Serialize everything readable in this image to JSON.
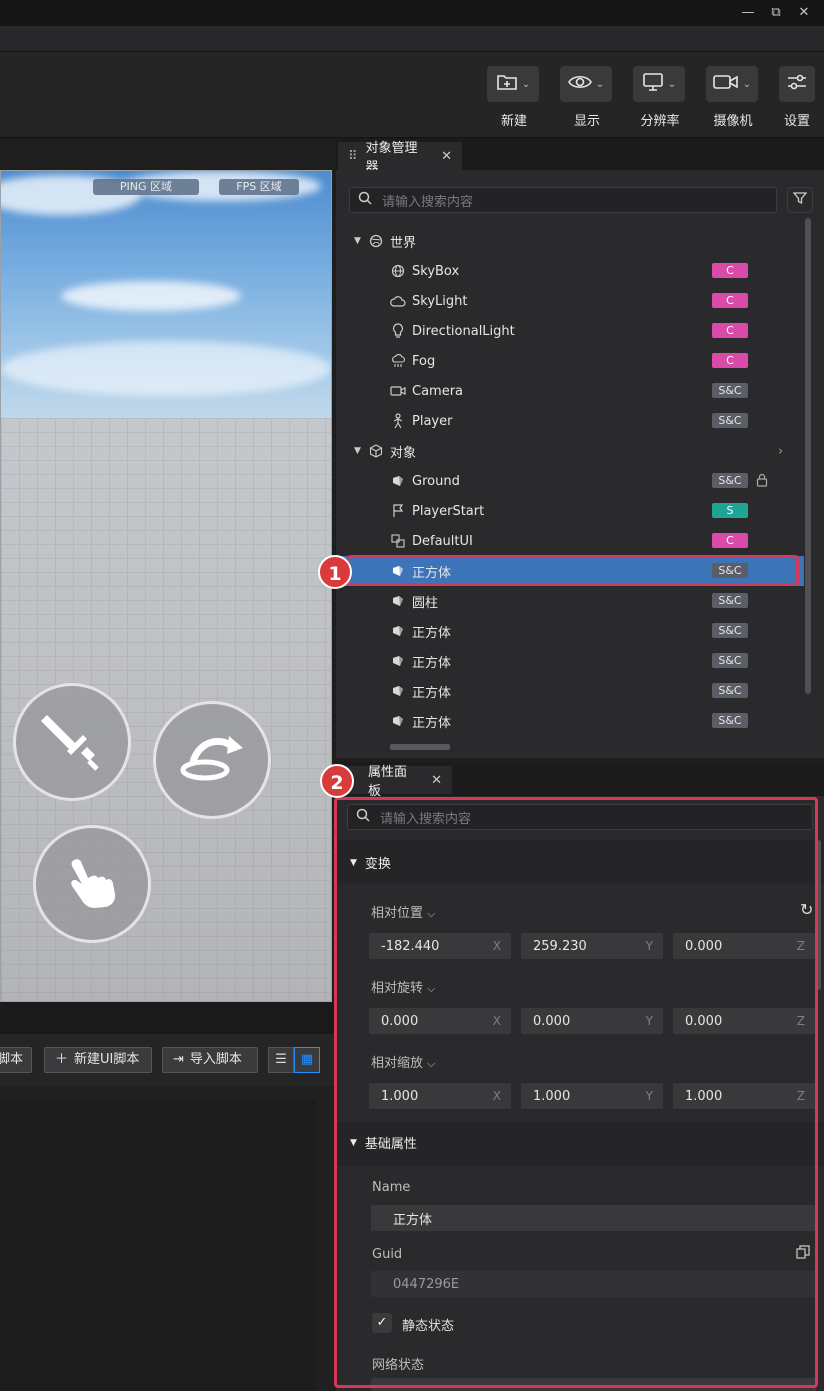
{
  "window": {
    "minimize": "—",
    "restore": "⧉",
    "close": "✕"
  },
  "toolbar": {
    "buttons": [
      {
        "label": "新建",
        "icon": "new-folder-icon"
      },
      {
        "label": "显示",
        "icon": "eye-icon"
      },
      {
        "label": "分辨率",
        "icon": "monitor-icon"
      },
      {
        "label": "摄像机",
        "icon": "camera-icon"
      },
      {
        "label": "设置",
        "icon": "settings-sliders-icon"
      }
    ]
  },
  "viewport": {
    "ping_label": "PING 区域",
    "fps_label": "FPS 区域"
  },
  "scripts": {
    "script_btn_partial": "脚本",
    "new_ui_script": "新建UI脚本",
    "import_script": "导入脚本"
  },
  "object_manager": {
    "tab_title": "对象管理器",
    "search_placeholder": "请输入搜索内容",
    "world_group": "世界",
    "objects_group": "对象",
    "items": [
      {
        "name": "SkyBox",
        "icon": "globe-icon",
        "badge": "C",
        "group": "world"
      },
      {
        "name": "SkyLight",
        "icon": "cloud-icon",
        "badge": "C",
        "group": "world"
      },
      {
        "name": "DirectionalLight",
        "icon": "bulb-icon",
        "badge": "C",
        "group": "world"
      },
      {
        "name": "Fog",
        "icon": "fog-icon",
        "badge": "C",
        "group": "world"
      },
      {
        "name": "Camera",
        "icon": "camera-icon",
        "badge": "S&C",
        "group": "world"
      },
      {
        "name": "Player",
        "icon": "person-icon",
        "badge": "S&C",
        "group": "world"
      },
      {
        "name": "Ground",
        "icon": "mesh-icon",
        "badge": "S&C",
        "group": "objects",
        "locked": true
      },
      {
        "name": "PlayerStart",
        "icon": "flag-icon",
        "badge": "S",
        "group": "objects"
      },
      {
        "name": "DefaultUI",
        "icon": "ui-icon",
        "badge": "C",
        "group": "objects"
      },
      {
        "name": "正方体",
        "icon": "mesh-icon",
        "badge": "S&C",
        "group": "objects",
        "selected": true
      },
      {
        "name": "圆柱",
        "icon": "mesh-icon",
        "badge": "S&C",
        "group": "objects"
      },
      {
        "name": "正方体",
        "icon": "mesh-icon",
        "badge": "S&C",
        "group": "objects"
      },
      {
        "name": "正方体",
        "icon": "mesh-icon",
        "badge": "S&C",
        "group": "objects"
      },
      {
        "name": "正方体",
        "icon": "mesh-icon",
        "badge": "S&C",
        "group": "objects"
      },
      {
        "name": "正方体",
        "icon": "mesh-icon",
        "badge": "S&C",
        "group": "objects"
      }
    ]
  },
  "property_panel": {
    "tab_title": "属性面板",
    "search_placeholder": "请输入搜索内容",
    "transform_section": "变换",
    "rel_position": {
      "label": "相对位置",
      "x": "-182.440",
      "y": "259.230",
      "z": "0.000"
    },
    "rel_rotation": {
      "label": "相对旋转",
      "x": "0.000",
      "y": "0.000",
      "z": "0.000"
    },
    "rel_scale": {
      "label": "相对缩放",
      "x": "1.000",
      "y": "1.000",
      "z": "1.000"
    },
    "axis_x": "X",
    "axis_y": "Y",
    "axis_z": "Z",
    "basic_section": "基础属性",
    "name_label": "Name",
    "name_value": "正方体",
    "guid_label": "Guid",
    "guid_value": "0447296E",
    "static_label": "静态状态",
    "network_label": "网络状态"
  },
  "annotations": {
    "marker1": "1",
    "marker2": "2",
    "accent": "#d6385a"
  }
}
